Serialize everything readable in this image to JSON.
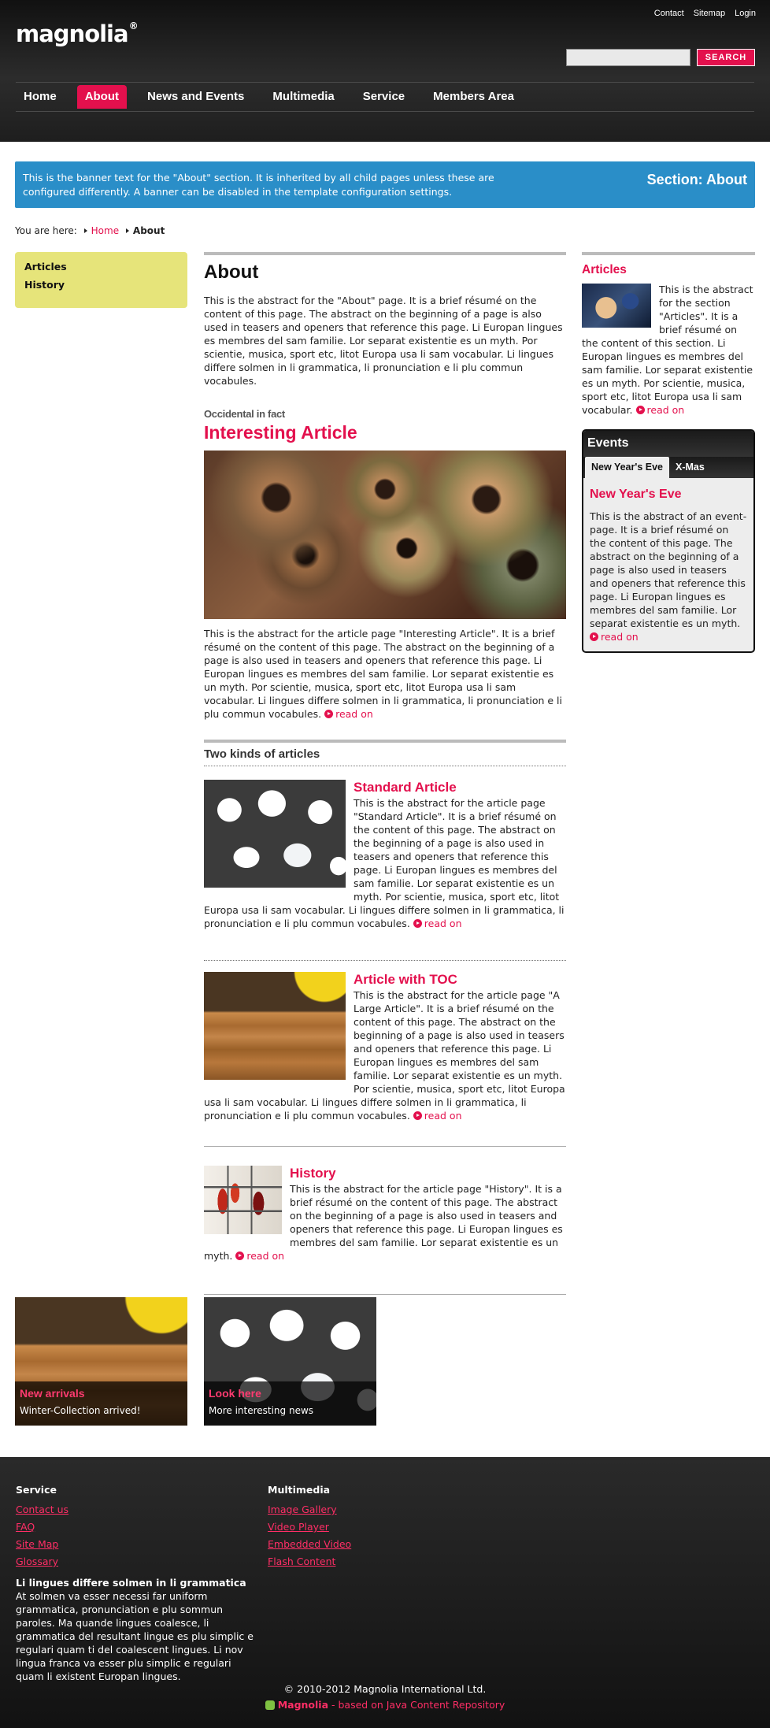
{
  "header": {
    "logo": "magnolia",
    "logo_mark": "®",
    "meta_nav": [
      "Contact",
      "Sitemap",
      "Login"
    ],
    "search": {
      "value": "",
      "button": "SEARCH"
    },
    "nav": [
      {
        "label": "Home",
        "active": false
      },
      {
        "label": "About",
        "active": true
      },
      {
        "label": "News and Events",
        "active": false
      },
      {
        "label": "Multimedia",
        "active": false
      },
      {
        "label": "Service",
        "active": false
      },
      {
        "label": "Members Area",
        "active": false
      }
    ]
  },
  "banner": {
    "text": "This is the banner text for the \"About\" section. It is inherited by all child pages unless these are configured differently. A banner can be disabled in the template configuration settings.",
    "section": "Section: About"
  },
  "breadcrumb": {
    "prefix": "You are here:",
    "items": [
      "Home",
      "About"
    ]
  },
  "subnav": [
    "Articles",
    "History"
  ],
  "main": {
    "title": "About",
    "abstract": "This is the abstract for the \"About\" page. It is a brief résumé on the content of this page. The abstract on the beginning of a page is also used in teasers and openers that reference this page. Li Europan lingues es membres del sam familie. Lor separat existentie es un myth. Por scientie, musica, sport etc, litot Europa usa li sam vocabular. Li lingues differe solmen in li grammatica, li pronunciation e li plu commun vocabules.",
    "featured": {
      "kicker": "Occidental in fact",
      "title": "Interesting Article",
      "text": "This is the abstract for the article page \"Interesting Article\". It is a brief résumé on the content of this page. The abstract on the beginning of a page is also used in teasers and openers that reference this page. Li Europan lingues es membres del sam familie. Lor separat existentie es un myth. Por scientie, musica, sport etc, litot Europa usa li sam vocabular. Li lingues differe solmen in li grammatica, li pronunciation e li plu commun vocabules.",
      "read_on": "read on"
    },
    "box": {
      "title": "Two kinds of articles",
      "items": [
        {
          "title": "Standard Article",
          "text": "This is the abstract for the article page \"Standard Article\". It is a brief résumé on the content of this page. The abstract on the beginning of a page is also used in teasers and openers that reference this page. Li Europan lingues es membres del sam familie. Lor separat existentie es un myth. Por scientie, musica, sport etc, litot Europa usa li sam vocabular. Li lingues differe solmen in li grammatica, li pronunciation e li plu commun vocabules.",
          "read_on": "read on"
        },
        {
          "title": "Article with TOC",
          "text": "This is the abstract for the article page \"A Large Article\". It is a brief résumé on the content of this page. The abstract on the beginning of a page is also used in teasers and openers that reference this page. Li Europan lingues es membres del sam familie. Lor separat existentie es un myth. Por scientie, musica, sport etc, litot Europa usa li sam vocabular. Li lingues differe solmen in li grammatica, li pronunciation e li plu commun vocabules.",
          "read_on": "read on"
        }
      ]
    },
    "history": {
      "title": "History",
      "text": "This is the abstract for the article page \"History\". It is a brief résumé on the content of this page. The abstract on the beginning of a page is also used in teasers and openers that reference this page. Li Europan lingues es membres del sam familie. Lor separat existentie es un myth.",
      "read_on": "read on"
    }
  },
  "right": {
    "articles": {
      "title": "Articles",
      "text": "This is the abstract for the section \"Articles\". It is a brief résumé on the content of this section. Li Europan lingues es membres del sam familie. Lor separat existentie es un myth. Por scientie, musica, sport etc, litot Europa usa li sam vocabular.",
      "read_on": "read on"
    },
    "events": {
      "title": "Events",
      "tabs": [
        "New Year's Eve",
        "X-Mas"
      ],
      "item_title": "New Year's Eve",
      "text": "This is the abstract of an event-page. It is a brief résumé on the content of this page. The abstract on the beginning of a page is also used in teasers and openers that reference this page. Li Europan lingues es membres del sam familie. Lor separat existentie es un myth.",
      "read_on": "read on"
    }
  },
  "promos": [
    {
      "title": "New arrivals",
      "text": "Winter-Collection arrived!"
    },
    {
      "title": "Look here",
      "text": "More interesting news"
    }
  ],
  "footer": {
    "service": {
      "title": "Service",
      "links": [
        "Contact us",
        "FAQ",
        "Site Map",
        "Glossary"
      ]
    },
    "multimedia": {
      "title": "Multimedia",
      "links": [
        "Image Gallery",
        "Video Player",
        "Embedded Video",
        "Flash Content"
      ]
    },
    "text_title": "Li lingues differe solmen in li grammatica",
    "text": "At solmen va esser necessi far uniform grammatica, pronunciation e plu sommun paroles. Ma quande lingues coalesce, li grammatica del resultant lingue es plu simplic e regulari quam ti del coalescent lingues. Li nov lingua franca va esser plu simplic e regulari quam li existent Europan lingues.",
    "copyright": "© 2010-2012 Magnolia International Ltd.",
    "powered_brand": "Magnolia",
    "powered_rest": " - based on Java Content Repository"
  },
  "colors": {
    "accent": "#e3104d",
    "banner": "#2a8ec8",
    "subnav": "#e6e47a"
  }
}
